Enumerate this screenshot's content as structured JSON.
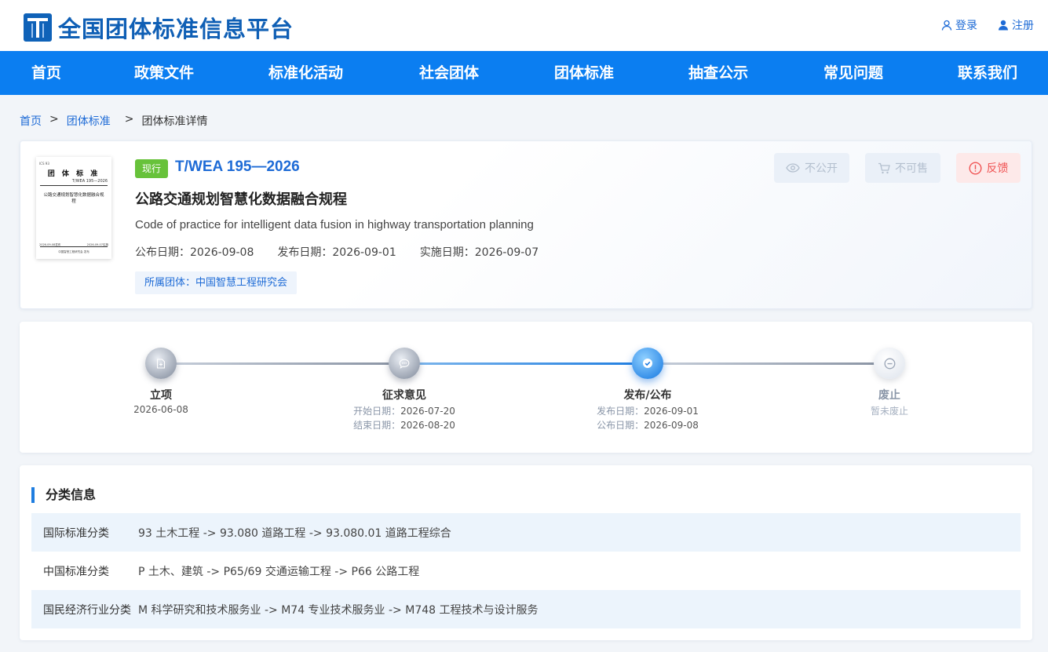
{
  "brand": {
    "title": "全国团体标准信息平台",
    "icon": "T-logo-icon"
  },
  "auth": {
    "login": "登录",
    "register": "注册"
  },
  "nav": [
    "首页",
    "政策文件",
    "标准化活动",
    "社会团体",
    "团体标准",
    "抽查公示",
    "常见问题",
    "联系我们"
  ],
  "breadcrumb": {
    "home": "首页",
    "sep1": ">",
    "section": "团体标准",
    "sep2": ">",
    "current": "团体标准详情"
  },
  "thumbnail": {
    "ics": "ICS 93",
    "heading": "团 体 标 准",
    "number": "T/WEA 195—2026",
    "name": "公路交通规划智慧化数据融合规程",
    "date_left": "2026-09-08发布",
    "date_right": "2026-09-07实施",
    "org": "中国智慧工程研究会 发布"
  },
  "standard": {
    "status": "现行",
    "number": "T/WEA 195—2026",
    "title": "公路交通规划智慧化数据融合规程",
    "title_en": "Code of practice for intelligent data fusion in highway transportation planning",
    "announce_date": "公布日期：2026-09-08",
    "publish_date": "发布日期：2026-09-01",
    "implement_date": "实施日期：2026-09-07",
    "organization": "所属团体：中国智慧工程研究会"
  },
  "actions": {
    "not_public": "不公开",
    "not_for_sale": "不可售",
    "feedback": "反馈"
  },
  "timeline": [
    {
      "label": "立项",
      "date": "2026-06-08"
    },
    {
      "label": "征求意见",
      "start_key": "开始日期：",
      "start": "2026-07-20",
      "end_key": "结束日期：",
      "end": "2026-08-20"
    },
    {
      "label": "发布/公布",
      "pub_key": "发布日期：",
      "pub": "2026-09-01",
      "ann_key": "公布日期：",
      "ann": "2026-09-08"
    },
    {
      "label": "废止",
      "note": "暂未废止"
    }
  ],
  "classification": {
    "title": "分类信息",
    "rows": [
      {
        "key": "国际标准分类",
        "value": "93 土木工程 -> 93.080 道路工程 -> 93.080.01 道路工程综合"
      },
      {
        "key": "中国标准分类",
        "value": "P 土木、建筑 -> P65/69 交通运输工程 -> P66 公路工程"
      },
      {
        "key": "国民经济行业分类",
        "value": "M 科学研究和技术服务业 -> M74 专业技术服务业 -> M748 工程技术与设计服务"
      }
    ]
  },
  "colors": {
    "nav": "#0b7ef1",
    "link": "#1e6bd6",
    "badge": "#67c23a",
    "feedback": "#f05454"
  }
}
